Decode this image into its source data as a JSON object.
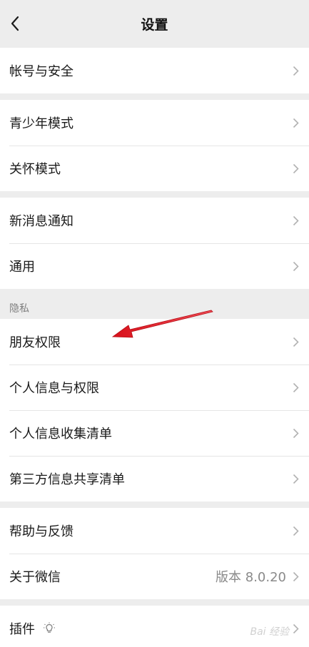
{
  "header": {
    "title": "设置"
  },
  "groups": {
    "account": [
      {
        "label": "帐号与安全"
      }
    ],
    "modes": [
      {
        "label": "青少年模式"
      },
      {
        "label": "关怀模式"
      }
    ],
    "general": [
      {
        "label": "新消息通知"
      },
      {
        "label": "通用"
      }
    ],
    "privacy_label": "隐私",
    "privacy": [
      {
        "label": "朋友权限"
      },
      {
        "label": "个人信息与权限"
      },
      {
        "label": "个人信息收集清单"
      },
      {
        "label": "第三方信息共享清单"
      }
    ],
    "about": [
      {
        "label": "帮助与反馈"
      },
      {
        "label": "关于微信",
        "value": "版本 8.0.20"
      }
    ],
    "plugins": [
      {
        "label": "插件"
      }
    ]
  },
  "watermark": "Bai 经验",
  "colors": {
    "background": "#ededed",
    "row_background": "#ffffff",
    "annotation_arrow": "#e8141c"
  },
  "icons": [
    "back-icon",
    "chevron-right-icon",
    "lightbulb-icon"
  ]
}
